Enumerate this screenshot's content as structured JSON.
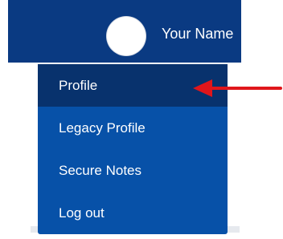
{
  "header": {
    "user_name": "Your Name",
    "avatar": "user-avatar"
  },
  "menu": {
    "items": [
      {
        "label": "Profile",
        "active": true
      },
      {
        "label": "Legacy Profile",
        "active": false
      },
      {
        "label": "Secure Notes",
        "active": false
      },
      {
        "label": "Log out",
        "active": false
      }
    ]
  },
  "annotation": {
    "icon": "arrow-left-icon",
    "color": "#e0161b"
  },
  "colors": {
    "topbar": "#0a3a82",
    "menu_background": "#0751a8",
    "menu_active": "#08326d",
    "text": "#ffffff"
  }
}
